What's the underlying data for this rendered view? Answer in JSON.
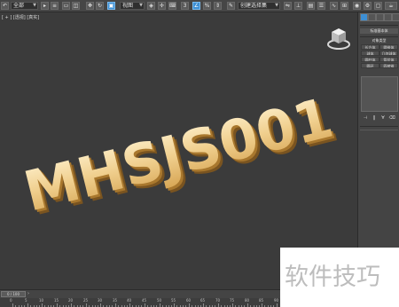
{
  "toolbar": {
    "selection_filter": "全部",
    "reference_coord": "视图",
    "named_selection": "创建选择集",
    "colors": {
      "active": "#3d8fd4",
      "bg": "#464646"
    }
  },
  "viewport": {
    "label": "[ + ] [透视] [真实]",
    "scene_text": "MHSJS001",
    "scene_text_color": "#e8c27a"
  },
  "command_panel": {
    "title": "标准基本体",
    "rows": [
      "对象类型",
      "名称和颜色"
    ],
    "cells": [
      "长方体",
      "圆锥体",
      "球体",
      "几何球体",
      "圆柱体",
      "管状体",
      "圆环",
      "四棱锥",
      "茶壶",
      "平面"
    ],
    "icons": [
      "create-icon",
      "modify-icon",
      "hierarchy-icon",
      "motion-icon",
      "display-icon"
    ]
  },
  "timeline": {
    "slider_label": "0 / 100",
    "ruler_ticks": [
      "0",
      "5",
      "10",
      "15",
      "20",
      "25",
      "30",
      "35",
      "40",
      "45",
      "50",
      "55",
      "60",
      "65",
      "70",
      "75",
      "80",
      "85",
      "90"
    ]
  },
  "watermark": {
    "text": "软件技巧"
  }
}
